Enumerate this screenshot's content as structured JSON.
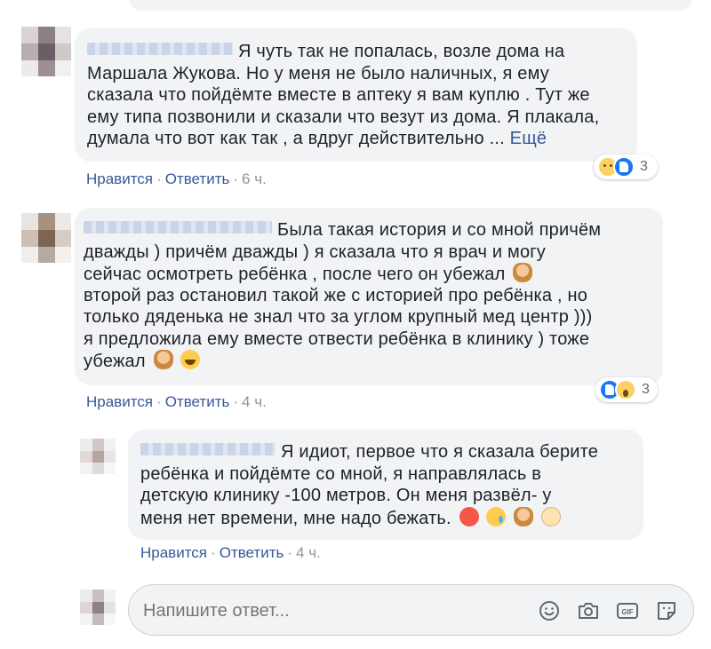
{
  "comments": [
    {
      "lines": [
        "Я чуть так не попалась, возле дома на",
        "Маршала Жукова. Но у меня не было наличных, я ему",
        "сказала что пойдёмте вместе в аптеку я вам куплю . Тут же",
        "ему типа позвонили и сказали что везут из дома. Я плакала,",
        "думала что вот как так , а вдруг действительно ..."
      ],
      "see_more": "Ещё",
      "like": "Нравится",
      "reply": "Ответить",
      "time": "6 ч.",
      "reactions": [
        "sad",
        "like"
      ],
      "reaction_count": "3"
    },
    {
      "lines": [
        "Была такая история и со мной причём",
        "дважды ) причём дважды ) я сказала что я врач и могу",
        "сейчас осмотреть ребёнка , после чего он убежал",
        "второй раз остановил такой же с историей про ребёнка , но",
        "только дяденька не знал что за углом крупный мед центр )))",
        "я предложила ему вместе отвести ребёнка в клинику ) тоже",
        "убежал"
      ],
      "emoji": [
        "person-facepalming",
        "tears-of-joy"
      ],
      "like": "Нравится",
      "reply": "Ответить",
      "time": "4 ч.",
      "reactions": [
        "like",
        "wow"
      ],
      "reaction_count": "3"
    },
    {
      "lines": [
        "Я идиот, первое что я сказала берите",
        "ребёнка и пойдёмте со мной, я направлялась в",
        "детскую клинику -100 метров. Он меня развёл- у",
        "меня нет времени, мне надо бежать."
      ],
      "emoji": [
        "angry-face",
        "sad-sweat-face",
        "person-facepalming",
        "shocked-face"
      ],
      "like": "Нравится",
      "reply": "Ответить",
      "time": "4 ч."
    }
  ],
  "reply_box": {
    "placeholder": "Напишите ответ...",
    "tools": [
      "emoji-icon",
      "camera-icon",
      "gif-icon",
      "sticker-icon"
    ]
  },
  "colors": {
    "link": "#385898",
    "bubble": "#f2f3f5",
    "muted": "#90949c"
  }
}
